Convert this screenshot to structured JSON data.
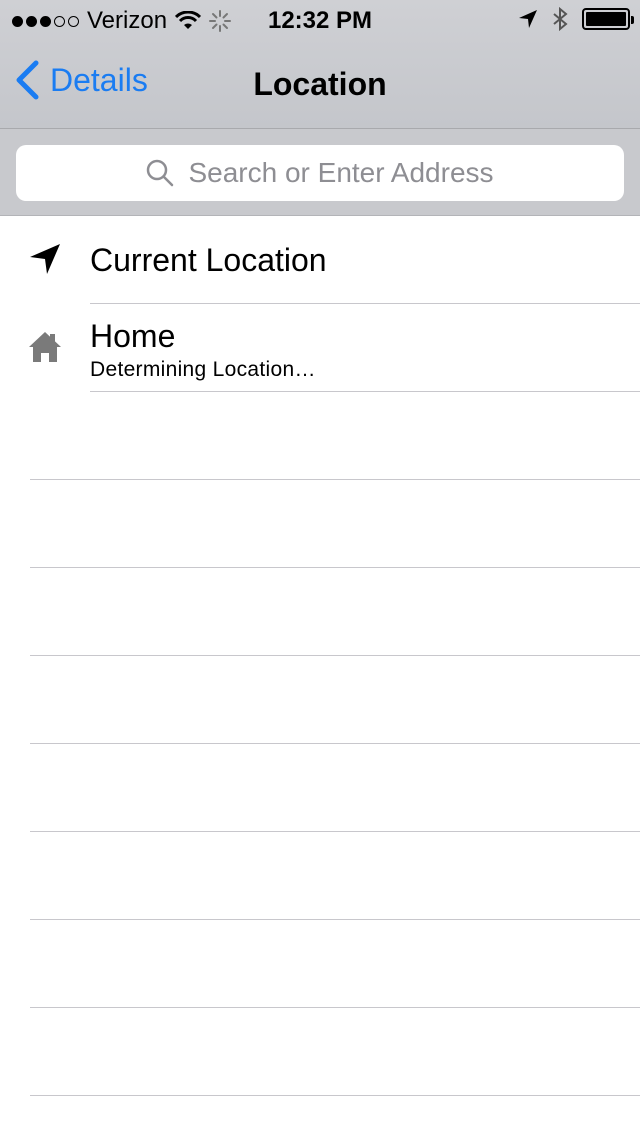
{
  "status_bar": {
    "carrier": "Verizon",
    "time": "12:32 PM",
    "signal_filled": 3,
    "signal_total": 5
  },
  "nav": {
    "back_label": "Details",
    "title": "Location"
  },
  "search": {
    "placeholder": "Search or Enter Address"
  },
  "rows": [
    {
      "title": "Current Location",
      "icon": "location-arrow-icon"
    },
    {
      "title": "Home",
      "subtitle": "Determining Location…",
      "icon": "home-icon"
    }
  ],
  "colors": {
    "accent": "#1a7cf2",
    "bar_bg": "#c8c9cd",
    "separator": "#c8c7cc",
    "placeholder": "#8e8e93"
  }
}
